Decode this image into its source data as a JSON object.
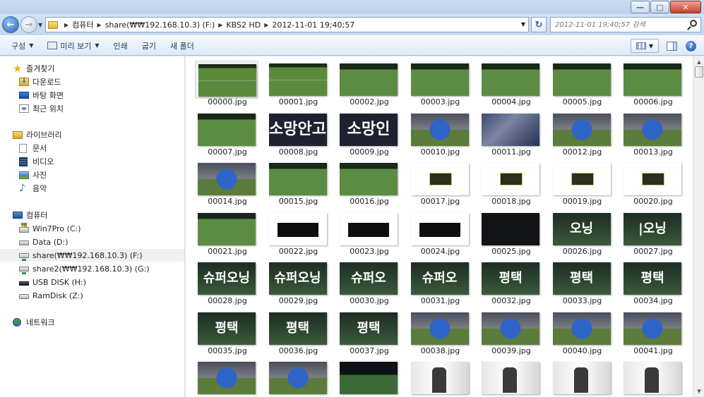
{
  "window": {
    "minimize_glyph": "—",
    "maximize_glyph": "□",
    "close_glyph": "✕"
  },
  "address": {
    "crumbs": [
      "컴퓨터",
      "share(₩₩192.168.10.3) (F:)",
      "KBS2 HD",
      "2012-11-01 19;40;57"
    ],
    "search_placeholder": "2012-11-01 19;40;57 검색"
  },
  "toolbar": {
    "organize": "구성",
    "preview": "미리 보기",
    "print": "인쇄",
    "burn": "굽기",
    "new_folder": "새 폴더",
    "help": "?"
  },
  "nav": {
    "favorites": "즐겨찾기",
    "downloads": "다운로드",
    "desktop": "바탕 화면",
    "recent": "최근 위치",
    "libraries": "라이브러리",
    "documents": "문서",
    "videos": "비디오",
    "pictures": "사진",
    "music": "음악",
    "computer": "컴퓨터",
    "drive_c": "Win7Pro (C:)",
    "drive_d": "Data (D:)",
    "drive_f": "share(₩₩192.168.10.3) (F:)",
    "drive_g": "share2(₩₩192.168.10.3) (G:)",
    "drive_h": "USB DISK (H:)",
    "drive_z": "RamDisk (Z:)",
    "network": "네트워크"
  },
  "files": [
    {
      "name": "00000.jpg",
      "thumb": "field",
      "selected": true
    },
    {
      "name": "00001.jpg",
      "thumb": "field"
    },
    {
      "name": "00002.jpg",
      "thumb": "green"
    },
    {
      "name": "00003.jpg",
      "thumb": "green"
    },
    {
      "name": "00004.jpg",
      "thumb": "green"
    },
    {
      "name": "00005.jpg",
      "thumb": "green"
    },
    {
      "name": "00006.jpg",
      "thumb": "green"
    },
    {
      "name": "00007.jpg",
      "thumb": "green"
    },
    {
      "name": "00008.jpg",
      "thumb": "text",
      "caption": "소망안고"
    },
    {
      "name": "00009.jpg",
      "thumb": "text",
      "caption": "소망인"
    },
    {
      "name": "00010.jpg",
      "thumb": "player"
    },
    {
      "name": "00011.jpg",
      "thumb": "crowd"
    },
    {
      "name": "00012.jpg",
      "thumb": "player"
    },
    {
      "name": "00013.jpg",
      "thumb": "player"
    },
    {
      "name": "00014.jpg",
      "thumb": "player"
    },
    {
      "name": "00015.jpg",
      "thumb": "green"
    },
    {
      "name": "00016.jpg",
      "thumb": "green"
    },
    {
      "name": "00017.jpg",
      "thumb": "score"
    },
    {
      "name": "00018.jpg",
      "thumb": "score"
    },
    {
      "name": "00019.jpg",
      "thumb": "score"
    },
    {
      "name": "00020.jpg",
      "thumb": "score"
    },
    {
      "name": "00021.jpg",
      "thumb": "green"
    },
    {
      "name": "00022.jpg",
      "thumb": "plain"
    },
    {
      "name": "00023.jpg",
      "thumb": "plain"
    },
    {
      "name": "00024.jpg",
      "thumb": "plain"
    },
    {
      "name": "00025.jpg",
      "thumb": "dark"
    },
    {
      "name": "00026.jpg",
      "thumb": "text2",
      "caption": "오닝"
    },
    {
      "name": "00027.jpg",
      "thumb": "text2",
      "caption": "|오닝"
    },
    {
      "name": "00028.jpg",
      "thumb": "text2",
      "caption": "슈퍼오닝"
    },
    {
      "name": "00029.jpg",
      "thumb": "text2",
      "caption": "슈퍼오닝"
    },
    {
      "name": "00030.jpg",
      "thumb": "text2",
      "caption": "슈퍼오"
    },
    {
      "name": "00031.jpg",
      "thumb": "text2",
      "caption": "슈퍼오"
    },
    {
      "name": "00032.jpg",
      "thumb": "text2",
      "caption": "평택"
    },
    {
      "name": "00033.jpg",
      "thumb": "text2",
      "caption": "평택"
    },
    {
      "name": "00034.jpg",
      "thumb": "text2",
      "caption": "평택"
    },
    {
      "name": "00035.jpg",
      "thumb": "text2",
      "caption": "평택"
    },
    {
      "name": "00036.jpg",
      "thumb": "text2",
      "caption": "평택"
    },
    {
      "name": "00037.jpg",
      "thumb": "text2",
      "caption": "평택"
    },
    {
      "name": "00038.jpg",
      "thumb": "player"
    },
    {
      "name": "00039.jpg",
      "thumb": "player"
    },
    {
      "name": "00040.jpg",
      "thumb": "player"
    },
    {
      "name": "00041.jpg",
      "thumb": "player"
    },
    {
      "name": "",
      "thumb": "player"
    },
    {
      "name": "",
      "thumb": "player"
    },
    {
      "name": "",
      "thumb": "night"
    },
    {
      "name": "",
      "thumb": "office"
    },
    {
      "name": "",
      "thumb": "office"
    },
    {
      "name": "",
      "thumb": "office"
    },
    {
      "name": "",
      "thumb": "office"
    }
  ]
}
